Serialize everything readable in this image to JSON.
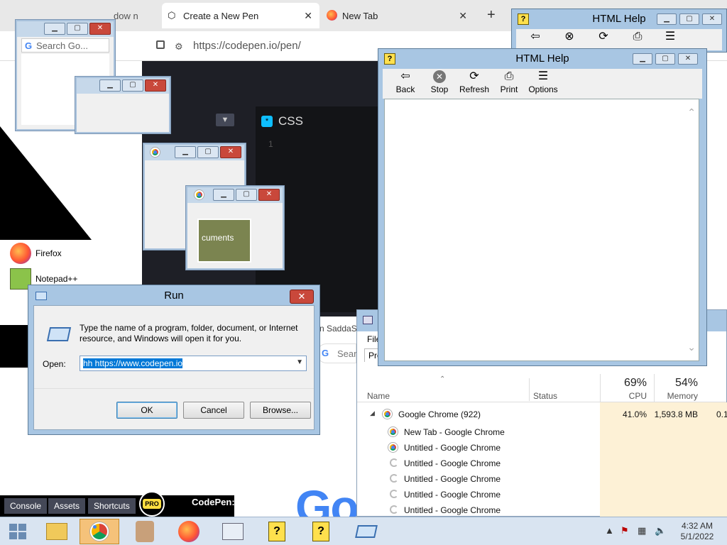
{
  "browser": {
    "tabs": [
      {
        "label": "dow n"
      },
      {
        "label": "Create a New Pen"
      },
      {
        "label": "New Tab"
      }
    ],
    "close_glyph": "✕",
    "new_tab_glyph": "+",
    "url": "https://codepen.io/pen/"
  },
  "codepen": {
    "css_tab_label": "CSS",
    "line_number": "1",
    "bottom_buttons": [
      "Console",
      "Assets",
      "Shortcuts"
    ],
    "pro_badge": "PRO",
    "footer_label": "CodePen:"
  },
  "smear": {
    "search_placeholder": "Search Go...",
    "documents_fragment": "cuments"
  },
  "applist": {
    "items": [
      {
        "label": "Firefox",
        "icon": "firefox-icon"
      },
      {
        "label": "Notepad++",
        "icon": "notepad-plus-plus-icon"
      }
    ]
  },
  "run_dialog": {
    "title": "Run",
    "description": "Type the name of a program, folder, document, or Internet resource, and Windows will open it for you.",
    "open_label": "Open:",
    "open_value": "hh https://www.codepen.io",
    "ok_label": "OK",
    "cancel_label": "Cancel",
    "browse_label": "Browse..."
  },
  "html_help": {
    "title": "HTML Help",
    "toolbar": [
      {
        "label": "Back",
        "icon": "back-arrow-icon"
      },
      {
        "label": "Stop",
        "icon": "stop-icon"
      },
      {
        "label": "Refresh",
        "icon": "refresh-icon"
      },
      {
        "label": "Print",
        "icon": "print-icon"
      },
      {
        "label": "Options",
        "icon": "options-icon"
      }
    ]
  },
  "behind": {
    "fragment": "n SaddaS",
    "search_fragment": "Sear",
    "google_fragment": "Go"
  },
  "task_manager": {
    "menu_file": "File",
    "tab_processes": "Pro",
    "columns": {
      "name": "Name",
      "status": "Status",
      "cpu": "CPU",
      "memory": "Memory"
    },
    "cpu_total": "69%",
    "memory_total": "54%",
    "rows": [
      {
        "name": "Google Chrome (922)",
        "cpu": "41.0%",
        "memory": "1,593.8 MB",
        "extra": "0.1"
      },
      {
        "name": "New Tab - Google Chrome"
      },
      {
        "name": "Untitled - Google Chrome"
      },
      {
        "name": "Untitled - Google Chrome"
      },
      {
        "name": "Untitled - Google Chrome"
      },
      {
        "name": "Untitled - Google Chrome"
      },
      {
        "name": "Untitled - Google Chrome"
      }
    ]
  },
  "taskbar": {
    "time": "4:32 AM",
    "date": "5/1/2022"
  },
  "colors": {
    "window_frame": "#a8c6e3",
    "close_red": "#c9483b",
    "codepen_dark": "#1e1f26",
    "taskbar": "#d9e4f1",
    "selection": "#0078d7"
  }
}
